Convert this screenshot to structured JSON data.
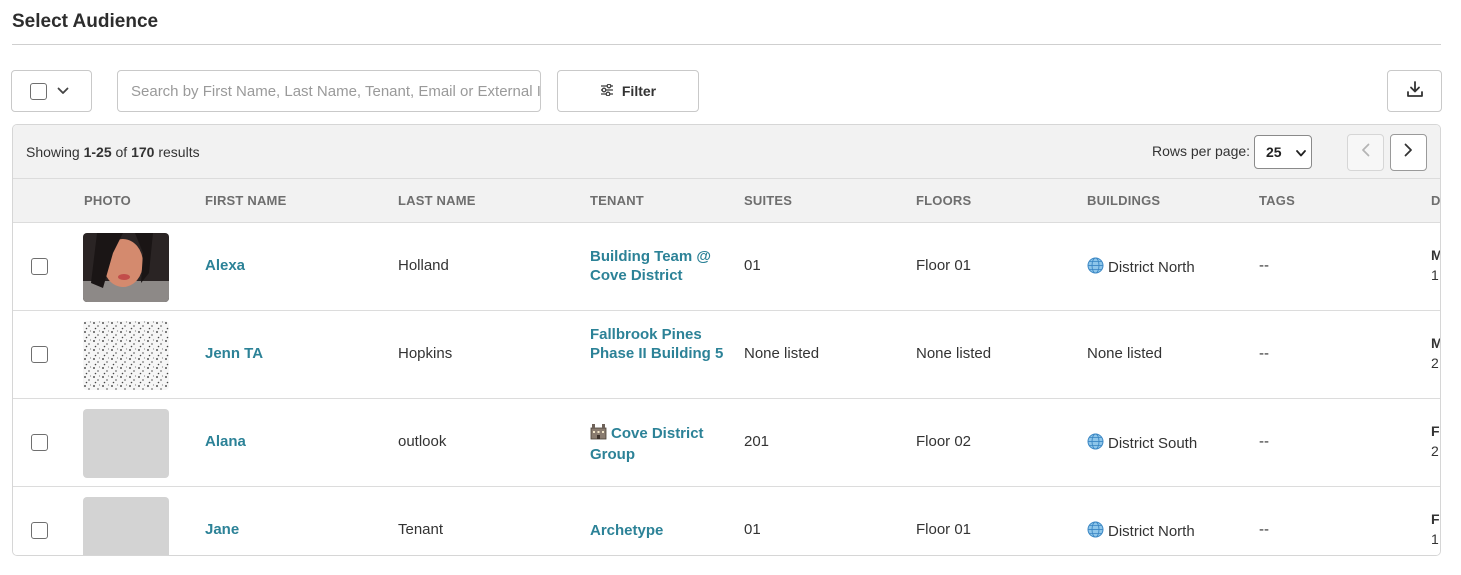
{
  "page": {
    "title": "Select Audience"
  },
  "toolbar": {
    "search_placeholder": "Search by First Name, Last Name, Tenant, Email or External ID",
    "filter_label": "Filter"
  },
  "table": {
    "showing_prefix": "Showing",
    "range": "1-25",
    "of_text": "of",
    "total": "170",
    "results_text": "results",
    "rows_per_page_label": "Rows per page:",
    "rows_per_page_value": "25",
    "columns": [
      "PHOTO",
      "FIRST NAME",
      "LAST NAME",
      "TENANT",
      "SUITES",
      "FLOORS",
      "BUILDINGS",
      "TAGS",
      "DA"
    ],
    "rows": [
      {
        "first_name": "Alexa",
        "last_name": "Holland",
        "tenant": "Building Team @ Cove District",
        "suites": "01",
        "floors": "Floor 01",
        "buildings": "District North",
        "tags": "--",
        "date_line1": "M",
        "date_line2": "1"
      },
      {
        "first_name": "Jenn TA",
        "last_name": "Hopkins",
        "tenant": "Fallbrook Pines Phase II Building 5",
        "suites": "None listed",
        "floors": "None listed",
        "buildings": "None listed",
        "tags": "--",
        "date_line1": "M",
        "date_line2": "2"
      },
      {
        "first_name": "Alana",
        "last_name": "outlook",
        "tenant": "Cove District Group",
        "suites": "201",
        "floors": "Floor 02",
        "buildings": "District South",
        "tags": "--",
        "date_line1": "F",
        "date_line2": "2"
      },
      {
        "first_name": "Jane",
        "last_name": "Tenant",
        "tenant": "Archetype",
        "suites": "01",
        "floors": "Floor 01",
        "buildings": "District North",
        "tags": "--",
        "date_line1": "F",
        "date_line2": "1"
      }
    ]
  },
  "colors": {
    "link": "#2c8297",
    "header_bg": "#f2f2f2",
    "border": "#dcdcdc"
  }
}
